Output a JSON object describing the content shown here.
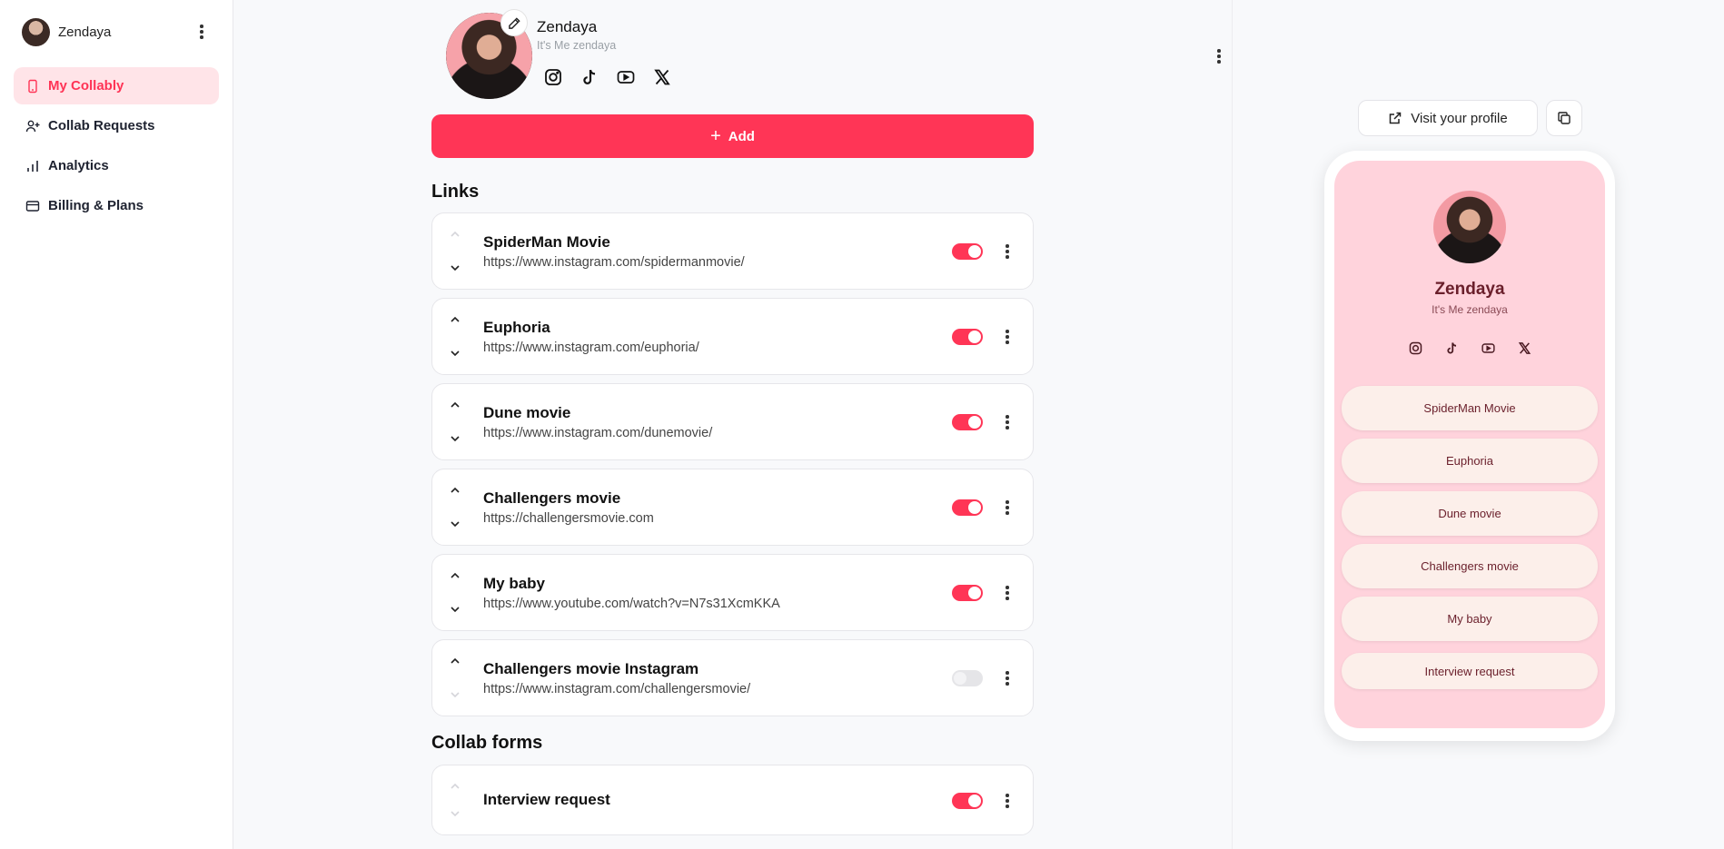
{
  "sidebar": {
    "user_name": "Zendaya",
    "items": [
      {
        "label": "My Collably",
        "active": true
      },
      {
        "label": "Collab Requests"
      },
      {
        "label": "Analytics"
      },
      {
        "label": "Billing & Plans"
      }
    ]
  },
  "profile": {
    "name": "Zendaya",
    "bio": "It's Me zendaya",
    "socials": [
      "instagram-icon",
      "tiktok-icon",
      "youtube-icon",
      "x-icon"
    ]
  },
  "add_button": {
    "label": "Add"
  },
  "sections": {
    "links_title": "Links",
    "forms_title": "Collab forms"
  },
  "links": [
    {
      "title": "SpiderMan Movie",
      "url": "https://www.instagram.com/spidermanmovie/",
      "enabled": true
    },
    {
      "title": "Euphoria",
      "url": "https://www.instagram.com/euphoria/",
      "enabled": true
    },
    {
      "title": "Dune movie",
      "url": "https://www.instagram.com/dunemovie/",
      "enabled": true
    },
    {
      "title": "Challengers movie",
      "url": "https://challengersmovie.com",
      "enabled": true
    },
    {
      "title": "My baby",
      "url": "https://www.youtube.com/watch?v=N7s31XcmKKA",
      "enabled": true
    },
    {
      "title": "Challengers movie Instagram",
      "url": "https://www.instagram.com/challengersmovie/",
      "enabled": false
    }
  ],
  "forms": [
    {
      "title": "Interview request",
      "enabled": true
    }
  ],
  "preview": {
    "visit_label": "Visit your profile",
    "name": "Zendaya",
    "bio": "It's Me zendaya",
    "links": [
      "SpiderMan Movie",
      "Euphoria",
      "Dune movie",
      "Challengers movie",
      "My baby"
    ],
    "form": "Interview request"
  },
  "colors": {
    "accent": "#ff3556",
    "active_bg": "#ffe4e8",
    "preview_bg": "#ffd3dc"
  }
}
